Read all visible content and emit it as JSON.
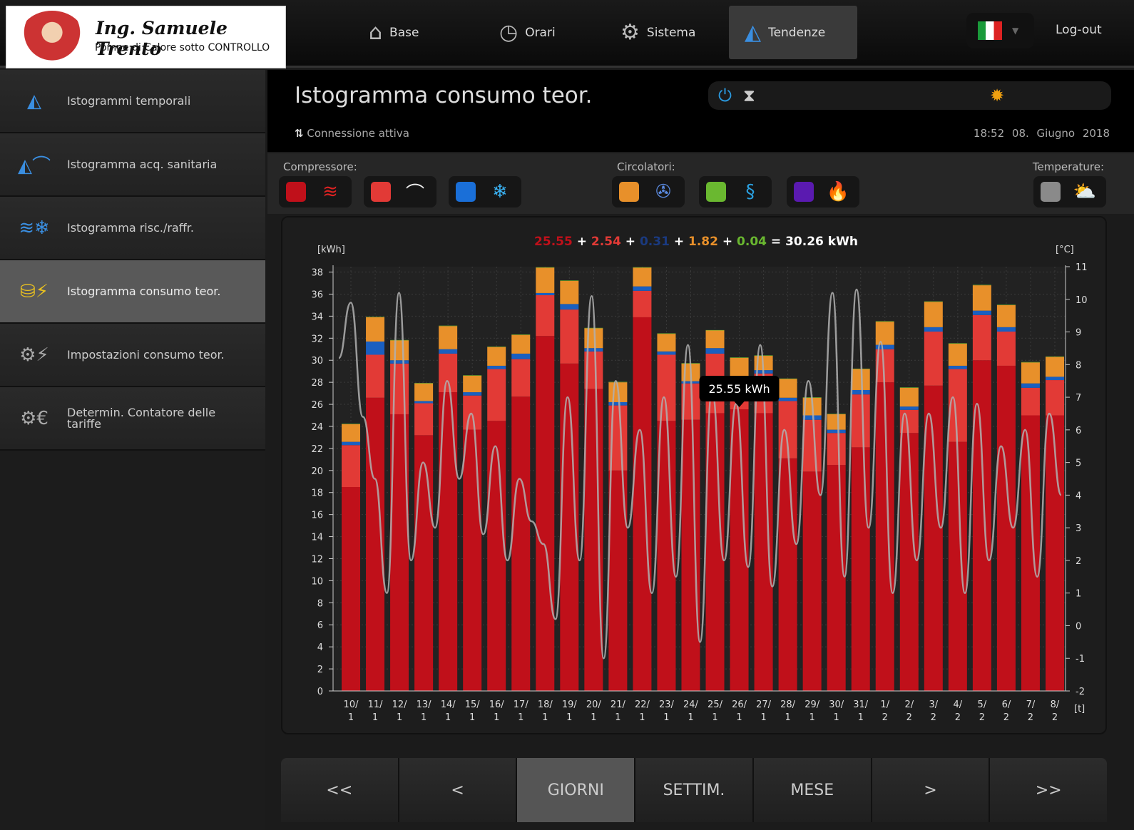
{
  "brand": {
    "name": "Ing. Samuele Trento",
    "tagline": "Pompe di Calore sotto CONTROLLO"
  },
  "nav": [
    {
      "label": "Base",
      "icon": "house-icon"
    },
    {
      "label": "Orari",
      "icon": "clock-icon"
    },
    {
      "label": "Sistema",
      "icon": "gear-icon"
    },
    {
      "label": "Tendenze",
      "icon": "chart-icon",
      "active": true
    }
  ],
  "language": "IT",
  "logout": "Log-out",
  "sidebar": [
    {
      "label": "Istogrammi temporali"
    },
    {
      "label": "Istogramma acq. sanitaria"
    },
    {
      "label": "Istogramma risc./raffr."
    },
    {
      "label": "Istogramma consumo teor.",
      "active": true
    },
    {
      "label": "Impostazioni consumo teor."
    },
    {
      "label": "Determin. Contatore delle tariffe"
    }
  ],
  "header": {
    "title": "Istogramma consumo teor.",
    "connection": "Connessione attiva",
    "time": "18:52",
    "date": "08. Giugno 2018"
  },
  "legend": {
    "compressor_label": "Compressore:",
    "circulators_label": "Circolatori:",
    "temperatures_label": "Temperature:",
    "colors": {
      "heating": "#c0101a",
      "dhw": "#e23a36",
      "cooling": "#1a6fd8",
      "circ1": "#e8902a",
      "circ2": "#6ab830",
      "circ3": "#5a1ab0",
      "temp": "#8a8a8a"
    }
  },
  "chart_data": {
    "type": "bar",
    "stacked": true,
    "summary": {
      "values": [
        "25.55",
        "2.54",
        "0.31",
        "1.82",
        "0.04"
      ],
      "total": "30.26 kWh"
    },
    "tooltip": "25.55 kWh",
    "ylabel": "[kWh]",
    "y2label": "[°C]",
    "xlabel": "[t]",
    "ylim": [
      0,
      38
    ],
    "y2lim": [
      -2,
      11
    ],
    "yticks": [
      0,
      2,
      4,
      6,
      8,
      10,
      12,
      14,
      16,
      18,
      20,
      22,
      24,
      26,
      28,
      30,
      32,
      34,
      36,
      38
    ],
    "y2ticks": [
      -2,
      -1,
      0,
      1,
      2,
      3,
      4,
      5,
      6,
      7,
      8,
      9,
      10,
      11
    ],
    "categories": [
      "10/1",
      "11/1",
      "12/1",
      "13/1",
      "14/1",
      "15/1",
      "16/1",
      "17/1",
      "18/1",
      "19/1",
      "20/1",
      "21/1",
      "22/1",
      "23/1",
      "24/1",
      "25/1",
      "26/1",
      "27/1",
      "28/1",
      "29/1",
      "30/1",
      "31/1",
      "1/2",
      "2/2",
      "3/2",
      "4/2",
      "5/2",
      "6/2",
      "7/2",
      "8/2"
    ],
    "series": [
      {
        "name": "Compressore riscaldamento",
        "color": "#c0101a",
        "values": [
          18.5,
          26.6,
          25.1,
          23.2,
          27.1,
          23.7,
          24.5,
          26.7,
          32.2,
          29.7,
          27.4,
          20.0,
          33.9,
          24.5,
          24.6,
          25.2,
          25.55,
          25.2,
          21.1,
          19.9,
          20.5,
          22.1,
          28.0,
          23.4,
          27.7,
          22.6,
          30.0,
          29.5,
          25.0,
          25.0
        ]
      },
      {
        "name": "Compressore acqua sanitaria",
        "color": "#e23a36",
        "values": [
          3.8,
          3.9,
          4.6,
          2.9,
          3.5,
          3.1,
          4.7,
          3.4,
          3.7,
          4.9,
          3.4,
          5.9,
          2.4,
          6.0,
          3.3,
          5.4,
          2.54,
          3.6,
          5.2,
          4.7,
          2.9,
          4.8,
          3.0,
          2.1,
          4.9,
          6.6,
          4.1,
          3.1,
          2.5,
          3.2
        ]
      },
      {
        "name": "Compressore raffrescamento",
        "color": "#1a5fc0",
        "values": [
          0.3,
          1.2,
          0.3,
          0.2,
          0.4,
          0.3,
          0.3,
          0.5,
          0.2,
          0.5,
          0.3,
          0.3,
          0.4,
          0.3,
          0.2,
          0.5,
          0.31,
          0.3,
          0.3,
          0.4,
          0.3,
          0.4,
          0.4,
          0.3,
          0.4,
          0.3,
          0.4,
          0.4,
          0.4,
          0.3
        ]
      },
      {
        "name": "Circolatore 1",
        "color": "#e8902a",
        "values": [
          1.6,
          2.2,
          1.8,
          1.6,
          2.1,
          1.5,
          1.7,
          1.7,
          2.3,
          2.1,
          1.8,
          1.8,
          1.7,
          1.6,
          1.6,
          1.6,
          1.82,
          1.3,
          1.7,
          1.6,
          1.4,
          1.9,
          2.1,
          1.7,
          2.3,
          2.0,
          2.3,
          2.0,
          1.9,
          1.8
        ]
      },
      {
        "name": "Circolatore 2",
        "color": "#6ab830",
        "values": [
          0.04,
          0.04,
          0.04,
          0.04,
          0.04,
          0.04,
          0.04,
          0.04,
          0.04,
          0.04,
          0.04,
          0.04,
          0.04,
          0.04,
          0.04,
          0.04,
          0.04,
          0.04,
          0.04,
          0.04,
          0.04,
          0.04,
          0.04,
          0.04,
          0.04,
          0.04,
          0.04,
          0.04,
          0.04,
          0.04
        ]
      }
    ],
    "highlighted_category": "26/1",
    "temperature": {
      "name": "Temperatura esterna",
      "color": "#b0b0b0",
      "values": [
        8.2,
        9.9,
        6.4,
        4.5,
        1.0,
        10.2,
        2.0,
        5.0,
        3.0,
        7.5,
        4.5,
        6.5,
        2.8,
        5.5,
        2.0,
        4.5,
        3.2,
        2.5,
        0.2,
        7.0,
        2.0,
        10.1,
        -1.0,
        7.5,
        3.0,
        6.0,
        1.0,
        7.0,
        1.5,
        8.6,
        -0.5,
        7.2,
        2.0,
        6.8,
        1.8,
        8.6,
        1.2,
        6.0,
        2.5,
        7.5,
        4.0,
        10.2,
        1.5,
        10.3,
        3.0,
        8.7,
        1.0,
        6.5,
        2.0,
        6.5,
        3.0,
        7.0,
        1.0,
        6.8,
        2.0,
        5.5,
        3.0,
        6.0,
        1.5,
        6.5,
        4.0
      ]
    }
  },
  "bottom": [
    {
      "label": "<<"
    },
    {
      "label": "<"
    },
    {
      "label": "GIORNI",
      "active": true
    },
    {
      "label": "SETTIM."
    },
    {
      "label": "MESE"
    },
    {
      "label": ">"
    },
    {
      "label": ">>"
    }
  ]
}
